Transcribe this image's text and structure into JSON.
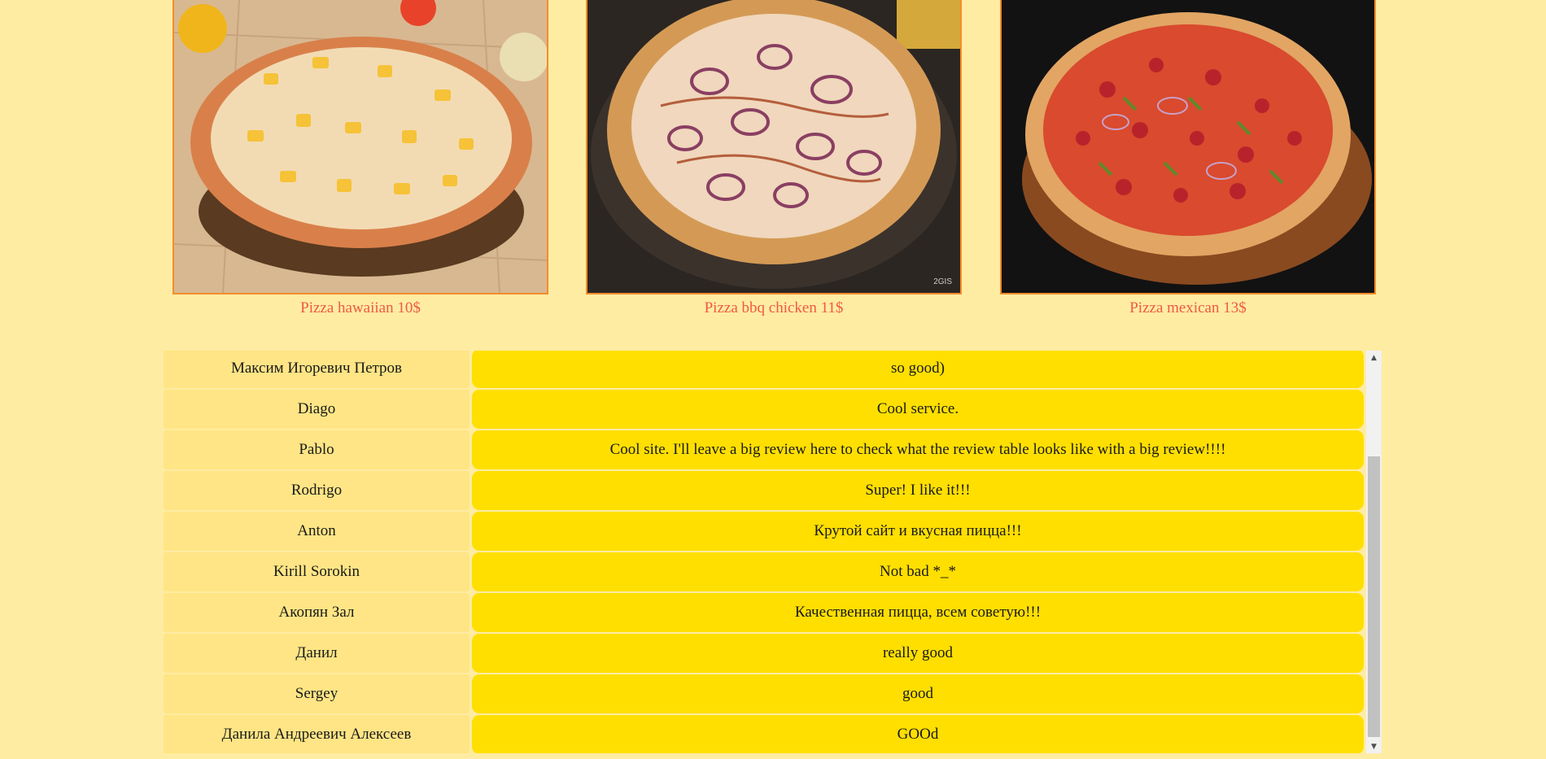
{
  "pizzas": [
    {
      "caption": "Pizza hawaiian 10$",
      "image": "hawaiian-pizza-photo"
    },
    {
      "caption": "Pizza bbq chicken 11$",
      "image": "bbq-chicken-pizza-photo",
      "watermark": "2GIS"
    },
    {
      "caption": "Pizza mexican 13$",
      "image": "mexican-pizza-photo"
    }
  ],
  "reviews": [
    {
      "name": "Максим Игоревич Петров",
      "text": "so good)"
    },
    {
      "name": "Diago",
      "text": "Cool service."
    },
    {
      "name": "Pablo",
      "text": "Cool site. I'll leave a big review here to check what the review table looks like with a big review!!!!"
    },
    {
      "name": "Rodrigo",
      "text": "Super! I like it!!!"
    },
    {
      "name": "Anton",
      "text": "Крутой сайт и вкусная пицца!!!"
    },
    {
      "name": "Kirill Sorokin",
      "text": "Not bad *_*"
    },
    {
      "name": "Акопян Зал",
      "text": "Качественная пицца, всем советую!!!"
    },
    {
      "name": "Данил",
      "text": "really good"
    },
    {
      "name": "Sergey",
      "text": "good"
    },
    {
      "name": "Данила Андреевич Алексеев",
      "text": "GOOd"
    }
  ],
  "scrollbar": {
    "up_icon": "scroll-up-arrow-icon",
    "down_icon": "scroll-down-arrow-icon"
  },
  "colors": {
    "page_background": "#ffeca3",
    "caption": "#ef5a42",
    "image_border": "#f58c2a",
    "review_name_bg": "#ffe585",
    "review_text_bg": "#ffdf00"
  }
}
